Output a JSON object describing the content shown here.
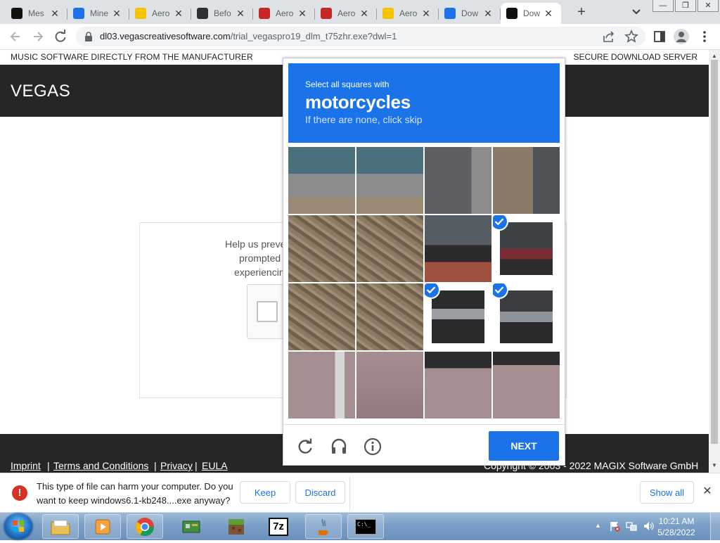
{
  "browser": {
    "tabs": [
      {
        "label": "Mes",
        "icon": "fd-icon",
        "color": "#111111"
      },
      {
        "label": "Mine",
        "icon": "google-drive-icon",
        "color": "#1a73e8"
      },
      {
        "label": "Aero",
        "icon": "aero-icon",
        "color": "#f5c400"
      },
      {
        "label": "Befo",
        "icon": "shield-icon",
        "color": "#303030"
      },
      {
        "label": "Aero",
        "icon": "netlife-icon",
        "color": "#c62828"
      },
      {
        "label": "Aero",
        "icon": "netlife-icon",
        "color": "#c62828"
      },
      {
        "label": "Aero",
        "icon": "aero-icon",
        "color": "#f5c400"
      },
      {
        "label": "Dow",
        "icon": "download-icon",
        "color": "#1a73e8"
      },
      {
        "label": "Dow",
        "icon": "magix-icon",
        "color": "#111111"
      }
    ],
    "active_tab": 8,
    "new_tab": "+",
    "close_glyph": "✕",
    "window_controls": [
      "—",
      "❐",
      "✕"
    ],
    "url_host": "dl03.vegascreativesoftware.com",
    "url_path": "/trial_vegaspro19_dlm_t75zhr.exe?dwl=1"
  },
  "page": {
    "tagline": "MUSIC SOFTWARE DIRECTLY FROM THE MANUFACTURER",
    "secure": "SECURE DOWNLOAD SERVER",
    "brand": "VEGAS",
    "help_lines": [
      "Help us preve",
      "prompted",
      "experiencin"
    ],
    "footer_links": [
      "Imprint",
      "Terms and Conditions",
      "Privacy",
      "EULA"
    ],
    "footer_sep": "|",
    "copyright": "Copyright © 2003 - 2022 MAGIX Software GmbH"
  },
  "captcha": {
    "instruction": "Select all squares with",
    "target": "motorcycles",
    "hint": "If there are none, click skip",
    "selected_tiles": [
      7,
      10,
      11
    ],
    "next_label": "NEXT",
    "accent": "#1a73e8"
  },
  "download": {
    "warning_glyph": "!",
    "warning": "This type of file can harm your computer. Do you want to keep windows6.1-kb248....exe anyway?",
    "keep": "Keep",
    "discard": "Discard",
    "show_all": "Show all",
    "close": "✕"
  },
  "taskbar": {
    "time": "10:21 AM",
    "date": "5/28/2022",
    "sevenzip": "7z",
    "cmd": "C:\\_"
  }
}
